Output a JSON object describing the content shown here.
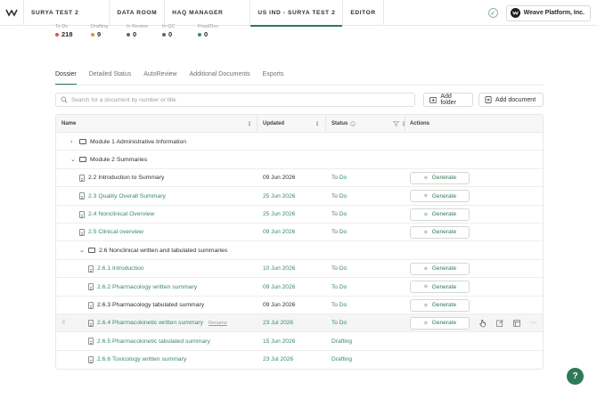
{
  "nav": {
    "items": [
      {
        "label": "SURYA TEST 2",
        "active": false
      },
      {
        "label": "DATA ROOM",
        "active": false
      },
      {
        "label": "HAQ MANAGER",
        "active": false
      },
      {
        "label": "US IND - SURYA TEST 2",
        "active": true
      },
      {
        "label": "EDITOR",
        "active": false
      }
    ],
    "org_name": "Weave Platform, Inc."
  },
  "stats": [
    {
      "label": "To Do",
      "value": "218",
      "color": "#d9534f"
    },
    {
      "label": "Drafting",
      "value": "9",
      "color": "#d79a28"
    },
    {
      "label": "In Review",
      "value": "0",
      "color": "#5a6b62"
    },
    {
      "label": "In QC",
      "value": "0",
      "color": "#5a6b62"
    },
    {
      "label": "Final/Doc",
      "value": "0",
      "color": "#3b8a63"
    }
  ],
  "tabs": [
    "Dossier",
    "Detailed Status",
    "AutoReview",
    "Additional Documents",
    "Exports"
  ],
  "search": {
    "placeholder": "Search for a document by number or title"
  },
  "buttons": {
    "add_folder": "Add folder",
    "add_document": "Add document",
    "generate": "Generate"
  },
  "table": {
    "headers": {
      "name": "Name",
      "updated": "Updated",
      "status": "Status",
      "actions": "Actions"
    },
    "rows": [
      {
        "type": "folder",
        "level": 0,
        "expanded": false,
        "name": "Module 1 Administrative Information"
      },
      {
        "type": "folder",
        "level": 0,
        "expanded": true,
        "name": "Module 2 Summaries"
      },
      {
        "type": "doc",
        "level": 1,
        "name": "2.2 Introduction to Summary",
        "updated": "09 Jun 2026",
        "status": "To Do",
        "link": false
      },
      {
        "type": "doc",
        "level": 1,
        "name": "2.3 Quality Overall Summary",
        "updated": "25 Jun 2026",
        "status": "To Do",
        "link": true
      },
      {
        "type": "doc",
        "level": 1,
        "name": "2.4 Nonclinical Overview",
        "updated": "25 Jun 2026",
        "status": "To Do",
        "link": true
      },
      {
        "type": "doc",
        "level": 1,
        "name": "2.5 Clinical overview",
        "updated": "09 Jun 2026",
        "status": "To Do",
        "link": true
      },
      {
        "type": "folder",
        "level": 1,
        "expanded": true,
        "name": "2.6 Nonclinical written and tabulated summaries"
      },
      {
        "type": "doc",
        "level": 2,
        "name": "2.6.1 Introduction",
        "updated": "10 Jun 2026",
        "status": "To Do",
        "link": true
      },
      {
        "type": "doc",
        "level": 2,
        "name": "2.6.2 Pharmacology written summary",
        "updated": "09 Jun 2026",
        "status": "To Do",
        "link": true
      },
      {
        "type": "doc",
        "level": 2,
        "name": "2.6.3 Pharmacology tabulated summary",
        "updated": "09 Jun 2026",
        "status": "To Do",
        "link": false
      },
      {
        "type": "doc",
        "level": 2,
        "name": "2.6.4 Pharmacokinetic written summary",
        "updated": "23 Jul 2026",
        "status": "To Do",
        "link": true,
        "hover": true,
        "rename": "Rename"
      },
      {
        "type": "doc",
        "level": 2,
        "name": "2.6.5 Pharmacokinetic tabulated summary",
        "updated": "15 Jun 2026",
        "status": "Drafting",
        "link": true,
        "nogen": true
      },
      {
        "type": "doc",
        "level": 2,
        "name": "2.6.6 Toxicology written summary",
        "updated": "23 Jul 2026",
        "status": "Drafting",
        "link": true,
        "nogen": true
      }
    ]
  },
  "help_label": "?"
}
